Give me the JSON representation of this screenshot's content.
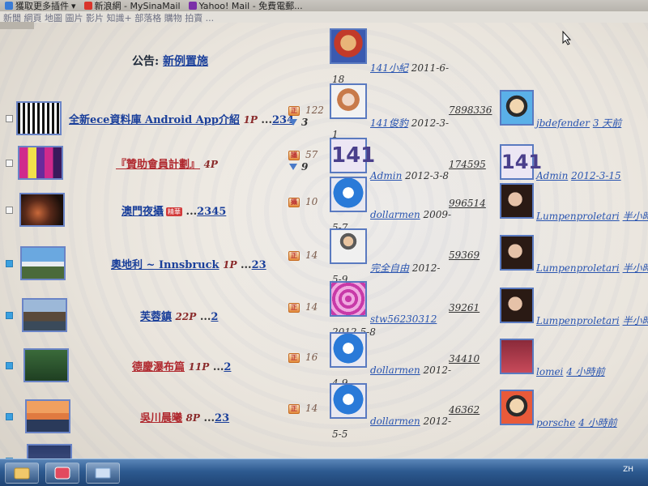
{
  "browser": {
    "bookmarks": [
      "獲取更多插件",
      "新浪網 - MySinaMail",
      "Yahoo! Mail - 免費電郵..."
    ],
    "headline": "新聞 網頁 地圖 圖片 影片 知識+ 部落格 購物 拍賣 ..."
  },
  "notice": {
    "prefix": "公告:",
    "link": "新例置施"
  },
  "threads": [
    {
      "title": "全新ece資料庫 Android App介紹",
      "title_color": "blue",
      "pages": "1P",
      "ellipsis": "...",
      "page_links": "234",
      "essence": "",
      "stat_tag": "正",
      "views": "122",
      "down": "3",
      "author": "141小紀",
      "date": "2011-6-",
      "date_cont": "18",
      "reply_stats": "",
      "last_user": "",
      "last_time": ""
    },
    {
      "title": "『贊助會員計劃』",
      "title_color": "red",
      "pages": "4P",
      "ellipsis": "",
      "page_links": "",
      "essence": "",
      "stat_tag": "議",
      "views": "57",
      "down": "9",
      "author": "141俊豹",
      "date": "2012-3-",
      "date_cont": "1",
      "reply_stats": "7898336",
      "last_user": "jbdefender",
      "last_time": "3 天前"
    },
    {
      "title": "澳門夜攝",
      "title_color": "blue",
      "pages": "",
      "ellipsis": "...",
      "page_links": "2345",
      "essence": "精華",
      "stat_tag": "攝",
      "views": "10",
      "down": "",
      "author": "Admin",
      "date": "2012-3-8",
      "date_cont": "",
      "reply_stats": "174595",
      "last_user": "Admin",
      "last_time": "2012-3-15"
    },
    {
      "title": "奧地利 ~ Innsbruck",
      "title_color": "blue",
      "pages": "1P",
      "ellipsis": "...",
      "page_links": "23",
      "essence": "",
      "stat_tag": "正",
      "views": "14",
      "down": "",
      "author": "dollarmen",
      "date": "2009-",
      "date_cont": "5-7",
      "reply_stats": "996514",
      "last_user": "Lumpenproletari",
      "last_time": "半小時前"
    },
    {
      "title": "芙蓉鎮",
      "title_color": "blue",
      "pages": "22P",
      "ellipsis": "...",
      "page_links": "2",
      "essence": "",
      "stat_tag": "正",
      "views": "14",
      "down": "",
      "author": "完全自由",
      "date": "2012-",
      "date_cont": "5-9",
      "reply_stats": "59369",
      "last_user": "Lumpenproletari",
      "last_time": "半小時前"
    },
    {
      "title": "德慶瀑布篇",
      "title_color": "red",
      "pages": "11P",
      "ellipsis": "...",
      "page_links": "2",
      "essence": "",
      "stat_tag": "正",
      "views": "16",
      "down": "",
      "author": "stw56230312",
      "date": "",
      "date_cont": "2012-5-8",
      "reply_stats": "39261",
      "last_user": "Lumpenproletari",
      "last_time": "半小時前"
    },
    {
      "title": "吳川晨曦",
      "title_color": "red",
      "pages": "8P",
      "ellipsis": "...",
      "page_links": "23",
      "essence": "",
      "stat_tag": "正",
      "views": "14",
      "down": "",
      "author": "dollarmen",
      "date": "2012-",
      "date_cont": "4-9",
      "reply_stats": "34410",
      "last_user": "lomei",
      "last_time": "4 小時前"
    },
    {
      "title": "",
      "title_color": "blue",
      "pages": "",
      "ellipsis": "",
      "page_links": "",
      "essence": "",
      "stat_tag": "",
      "views": "",
      "down": "",
      "author": "dollarmen",
      "date": "2012-",
      "date_cont": "5-5",
      "reply_stats": "46362",
      "last_user": "porsche",
      "last_time": "4 小時前"
    }
  ],
  "taskbar": {
    "clock": "ZH"
  },
  "colors": {
    "link": "#1a3f9a",
    "red_title": "#b0282e",
    "frame": "#5a7ac0"
  }
}
